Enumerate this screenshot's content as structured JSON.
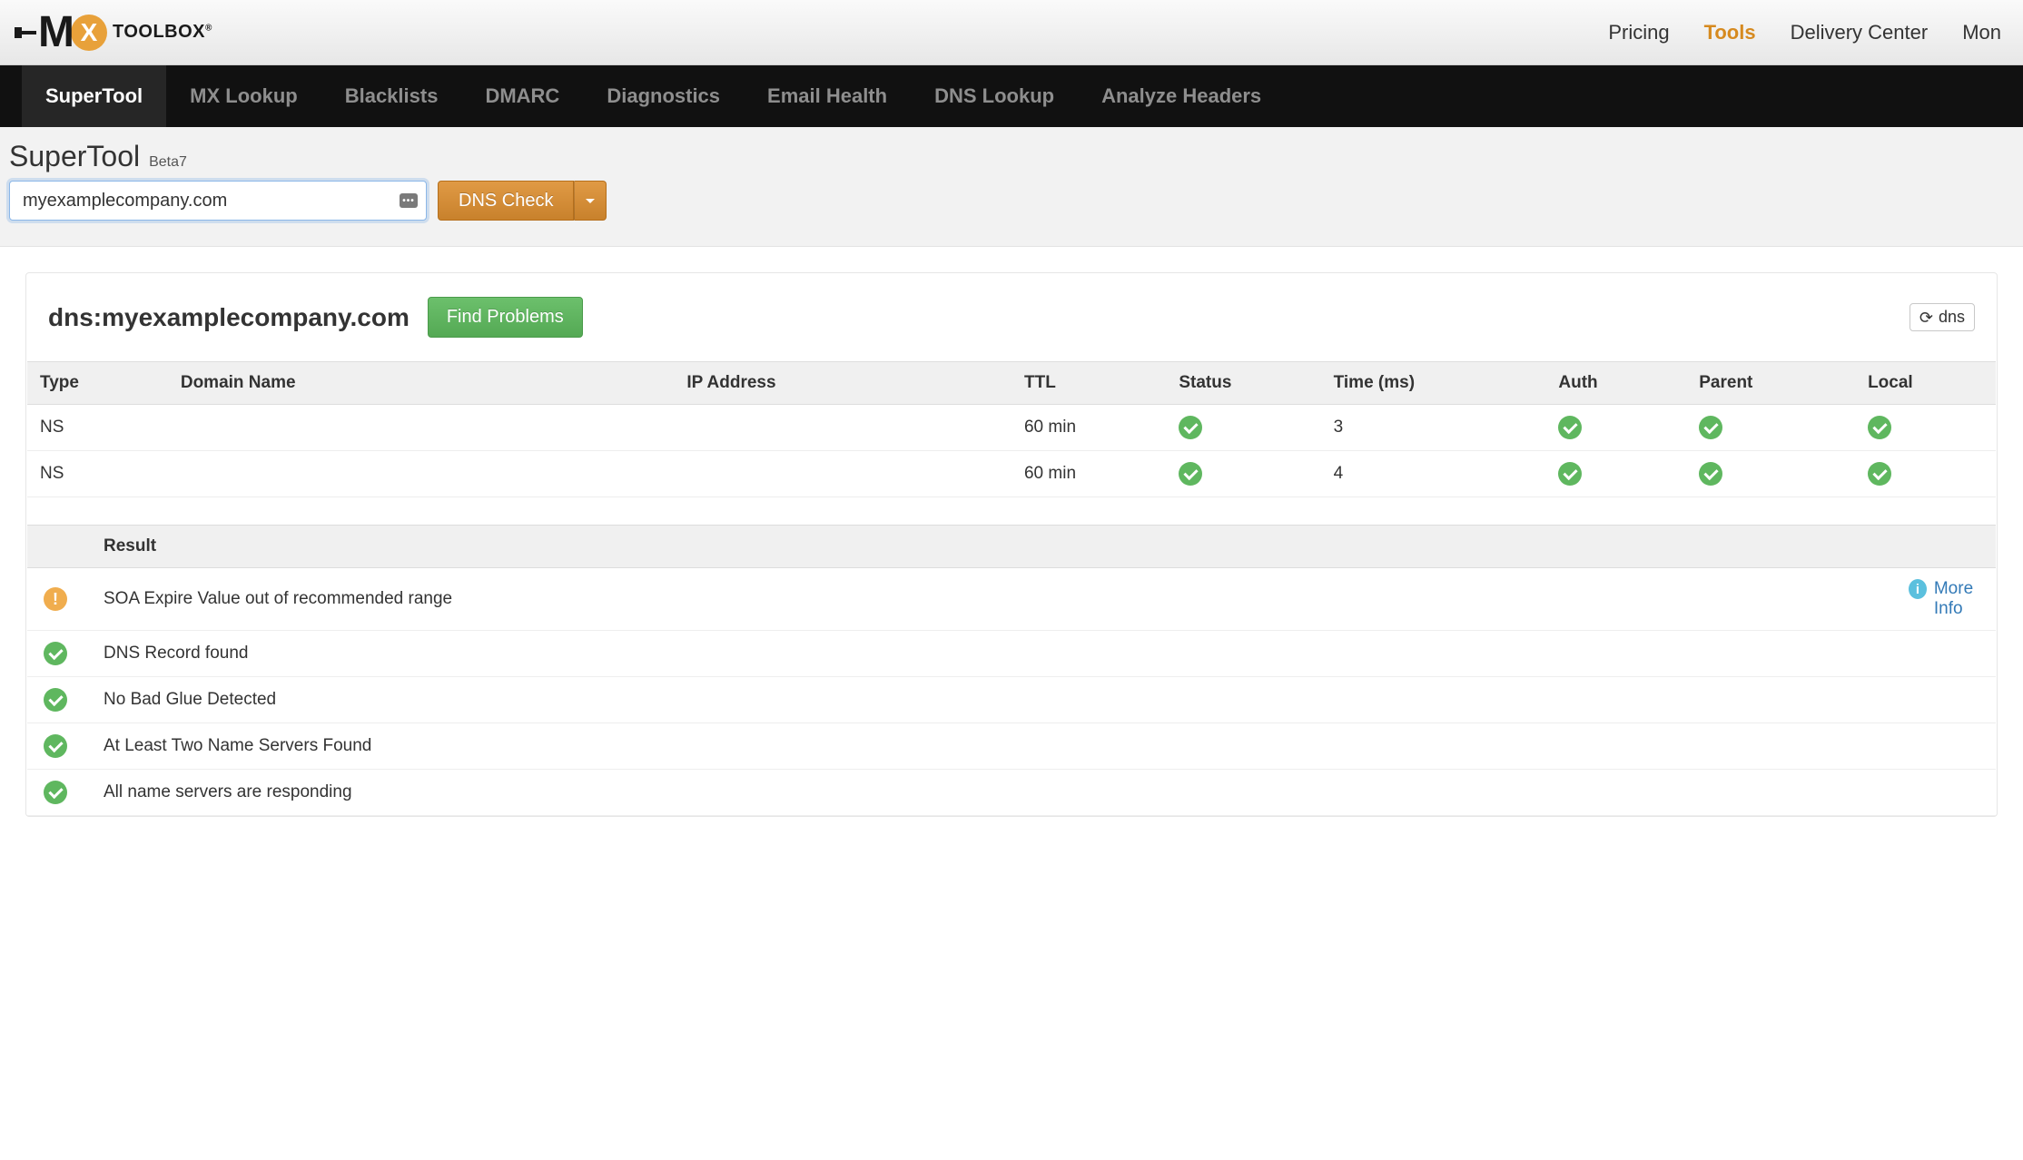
{
  "brand": {
    "toolbox": "TOOLBOX",
    "reg": "®"
  },
  "top_nav": {
    "pricing": "Pricing",
    "tools": "Tools",
    "delivery_center": "Delivery Center",
    "mon": "Mon"
  },
  "dark_tabs": {
    "supertool": "SuperTool",
    "mx_lookup": "MX Lookup",
    "blacklists": "Blacklists",
    "dmarc": "DMARC",
    "diagnostics": "Diagnostics",
    "email_health": "Email Health",
    "dns_lookup": "DNS Lookup",
    "analyze_headers": "Analyze Headers"
  },
  "tool": {
    "title": "SuperTool",
    "beta": "Beta7",
    "input_value": "myexamplecompany.com",
    "action_label": "DNS Check"
  },
  "results": {
    "heading": "dns:myexamplecompany.com",
    "find_problems": "Find Problems",
    "refresh_label": "dns"
  },
  "records_table": {
    "headers": {
      "type": "Type",
      "domain": "Domain Name",
      "ip": "IP Address",
      "ttl": "TTL",
      "status": "Status",
      "time": "Time (ms)",
      "auth": "Auth",
      "parent": "Parent",
      "local": "Local"
    },
    "rows": [
      {
        "type": "NS",
        "domain": "",
        "ip": "",
        "ttl": "60 min",
        "status": "ok",
        "time": "3",
        "auth": "ok",
        "parent": "ok",
        "local": "ok"
      },
      {
        "type": "NS",
        "domain": "",
        "ip": "",
        "ttl": "60 min",
        "status": "ok",
        "time": "4",
        "auth": "ok",
        "parent": "ok",
        "local": "ok"
      }
    ]
  },
  "checks_table": {
    "headers": {
      "result": "Result"
    },
    "more_info": "More Info",
    "rows": [
      {
        "status": "warn",
        "result": "SOA Expire Value out of recommended range",
        "more": true
      },
      {
        "status": "ok",
        "result": "DNS Record found",
        "more": false
      },
      {
        "status": "ok",
        "result": "No Bad Glue Detected",
        "more": false
      },
      {
        "status": "ok",
        "result": "At Least Two Name Servers Found",
        "more": false
      },
      {
        "status": "ok",
        "result": "All name servers are responding",
        "more": false
      }
    ]
  }
}
